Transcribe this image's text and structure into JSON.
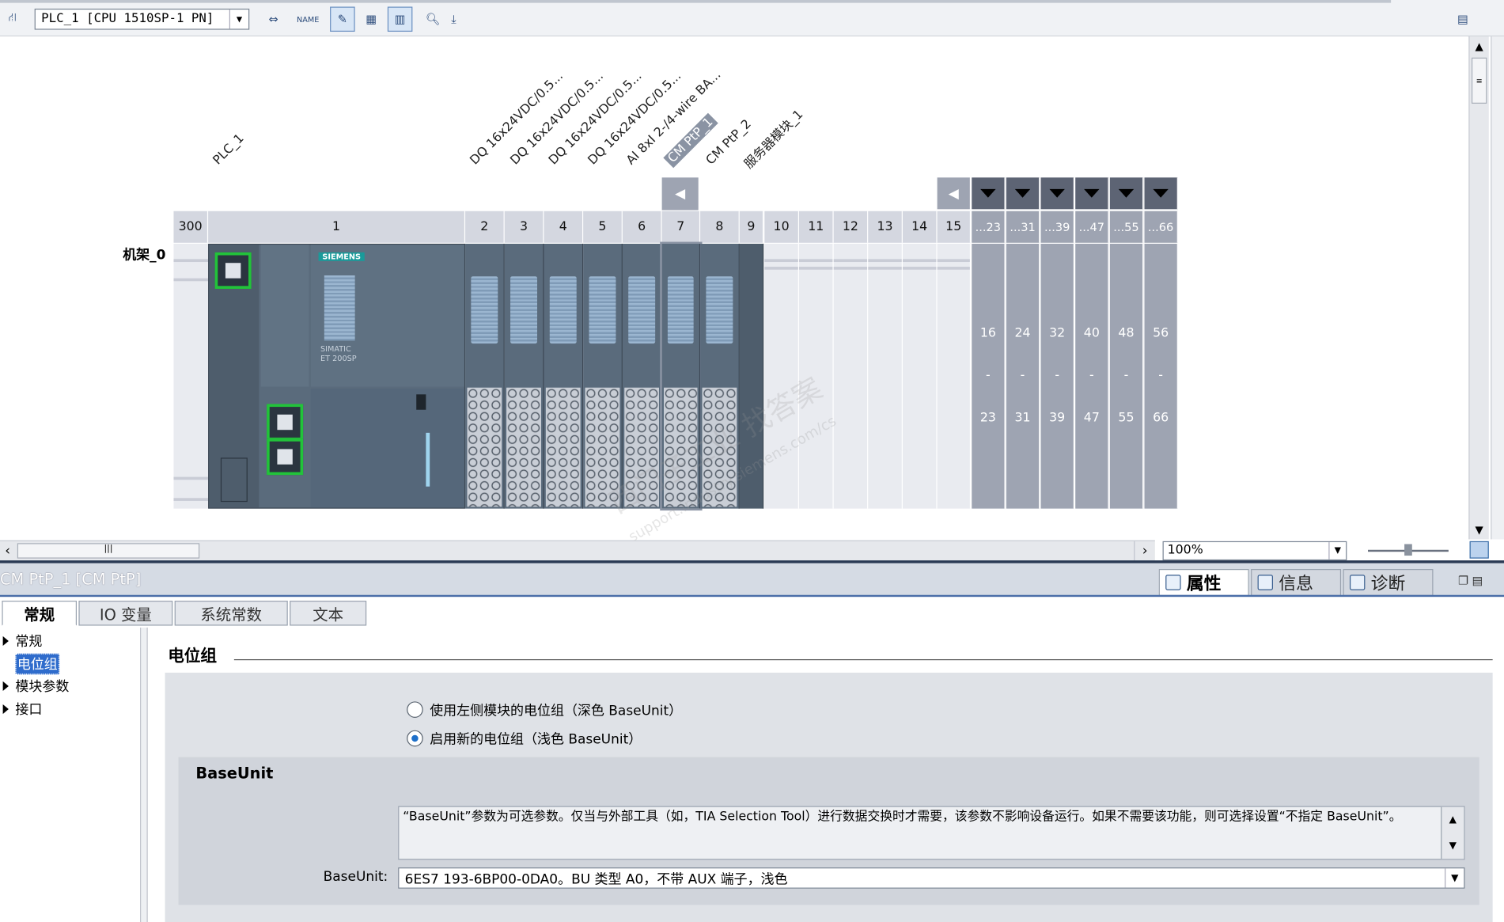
{
  "toolbar": {
    "device_select": "PLC_1 [CPU 1510SP-1 PN]",
    "zoom_value": "100%"
  },
  "rack": {
    "name": "机架_0",
    "slot_numbers": [
      "300",
      "1",
      "2",
      "3",
      "4",
      "5",
      "6",
      "7",
      "8",
      "9",
      "10",
      "11",
      "12",
      "13",
      "14",
      "15"
    ],
    "extra_slot_headers": [
      "...23",
      "...31",
      "...39",
      "...47",
      "...55",
      "...66"
    ],
    "extra_slot_ranges": [
      {
        "start": "16",
        "sep": "-",
        "end": "23"
      },
      {
        "start": "24",
        "sep": "-",
        "end": "31"
      },
      {
        "start": "32",
        "sep": "-",
        "end": "39"
      },
      {
        "start": "40",
        "sep": "-",
        "end": "47"
      },
      {
        "start": "48",
        "sep": "-",
        "end": "55"
      },
      {
        "start": "56",
        "sep": "-",
        "end": "66"
      }
    ],
    "module_labels": [
      "PLC_1",
      "DQ 16x24VDC/0.5...",
      "DQ 16x24VDC/0.5...",
      "DQ 16x24VDC/0.5...",
      "DQ 16x24VDC/0.5...",
      "AI 8xI 2-/4-wire BA...",
      "CM PtP_1",
      "CM PtP_2",
      "服务器模块_1"
    ],
    "cpu_brand": "SIEMENS",
    "cpu_model_line1": "SIMATIC",
    "cpu_model_line2": "ET 200SP"
  },
  "watermark": {
    "line1": "西门子工业 找答案",
    "line2": "support.industry.siemens.com/cs"
  },
  "inspector": {
    "title": "CM PtP_1 [CM PtP]",
    "panel_tabs": [
      "属性",
      "信息",
      "诊断"
    ],
    "tabs": [
      "常规",
      "IO 变量",
      "系统常数",
      "文本"
    ],
    "tree": [
      "常规",
      "电位组",
      "模块参数",
      "接口"
    ],
    "section_title": "电位组",
    "radio_options": [
      "使用左侧模块的电位组（深色 BaseUnit）",
      "启用新的电位组（浅色 BaseUnit）"
    ],
    "baseunit_heading": "BaseUnit",
    "info_text": "“BaseUnit”参数为可选参数。仅当与外部工具（如，TIA Selection Tool）进行数据交换时才需要，该参数不影响设备运行。如果不需要该功能，则可选择设置“不指定 BaseUnit”。",
    "baseunit_label": "BaseUnit:",
    "baseunit_value": "6ES7 193-6BP00-0DA0。BU 类型 A0，不带 AUX 端子，浅色"
  }
}
